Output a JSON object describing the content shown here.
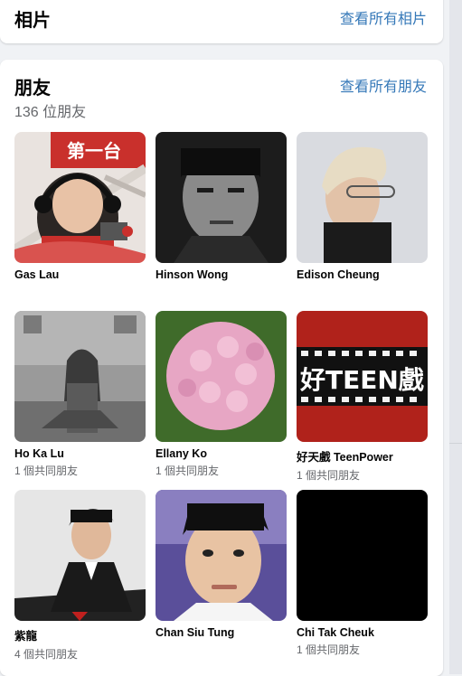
{
  "photos_section": {
    "title": "相片",
    "see_all": "查看所有相片"
  },
  "friends_section": {
    "title": "朋友",
    "see_all": "查看所有朋友",
    "count": "136 位朋友",
    "friends": [
      {
        "name": "Gas Lau",
        "mutual": ""
      },
      {
        "name": "Hinson Wong",
        "mutual": ""
      },
      {
        "name": "Edison Cheung",
        "mutual": ""
      },
      {
        "name": "Ho Ka Lu",
        "mutual": "1 個共同朋友"
      },
      {
        "name": "Ellany Ko",
        "mutual": "1 個共同朋友"
      },
      {
        "name": "好天戲 TeenPower",
        "mutual": "1 個共同朋友"
      },
      {
        "name": "紫龍",
        "mutual": "4 個共同朋友"
      },
      {
        "name": "Chan Siu Tung",
        "mutual": ""
      },
      {
        "name": "Chi Tak Cheuk",
        "mutual": "1 個共同朋友"
      }
    ],
    "photo_texts": {
      "radio_sign": "第一台",
      "teenpower_logo": "好TEEN戲"
    }
  },
  "colors": {
    "link": "#3578b8",
    "secondary_text": "#65676b",
    "page_bg": "#f0f2f5"
  }
}
